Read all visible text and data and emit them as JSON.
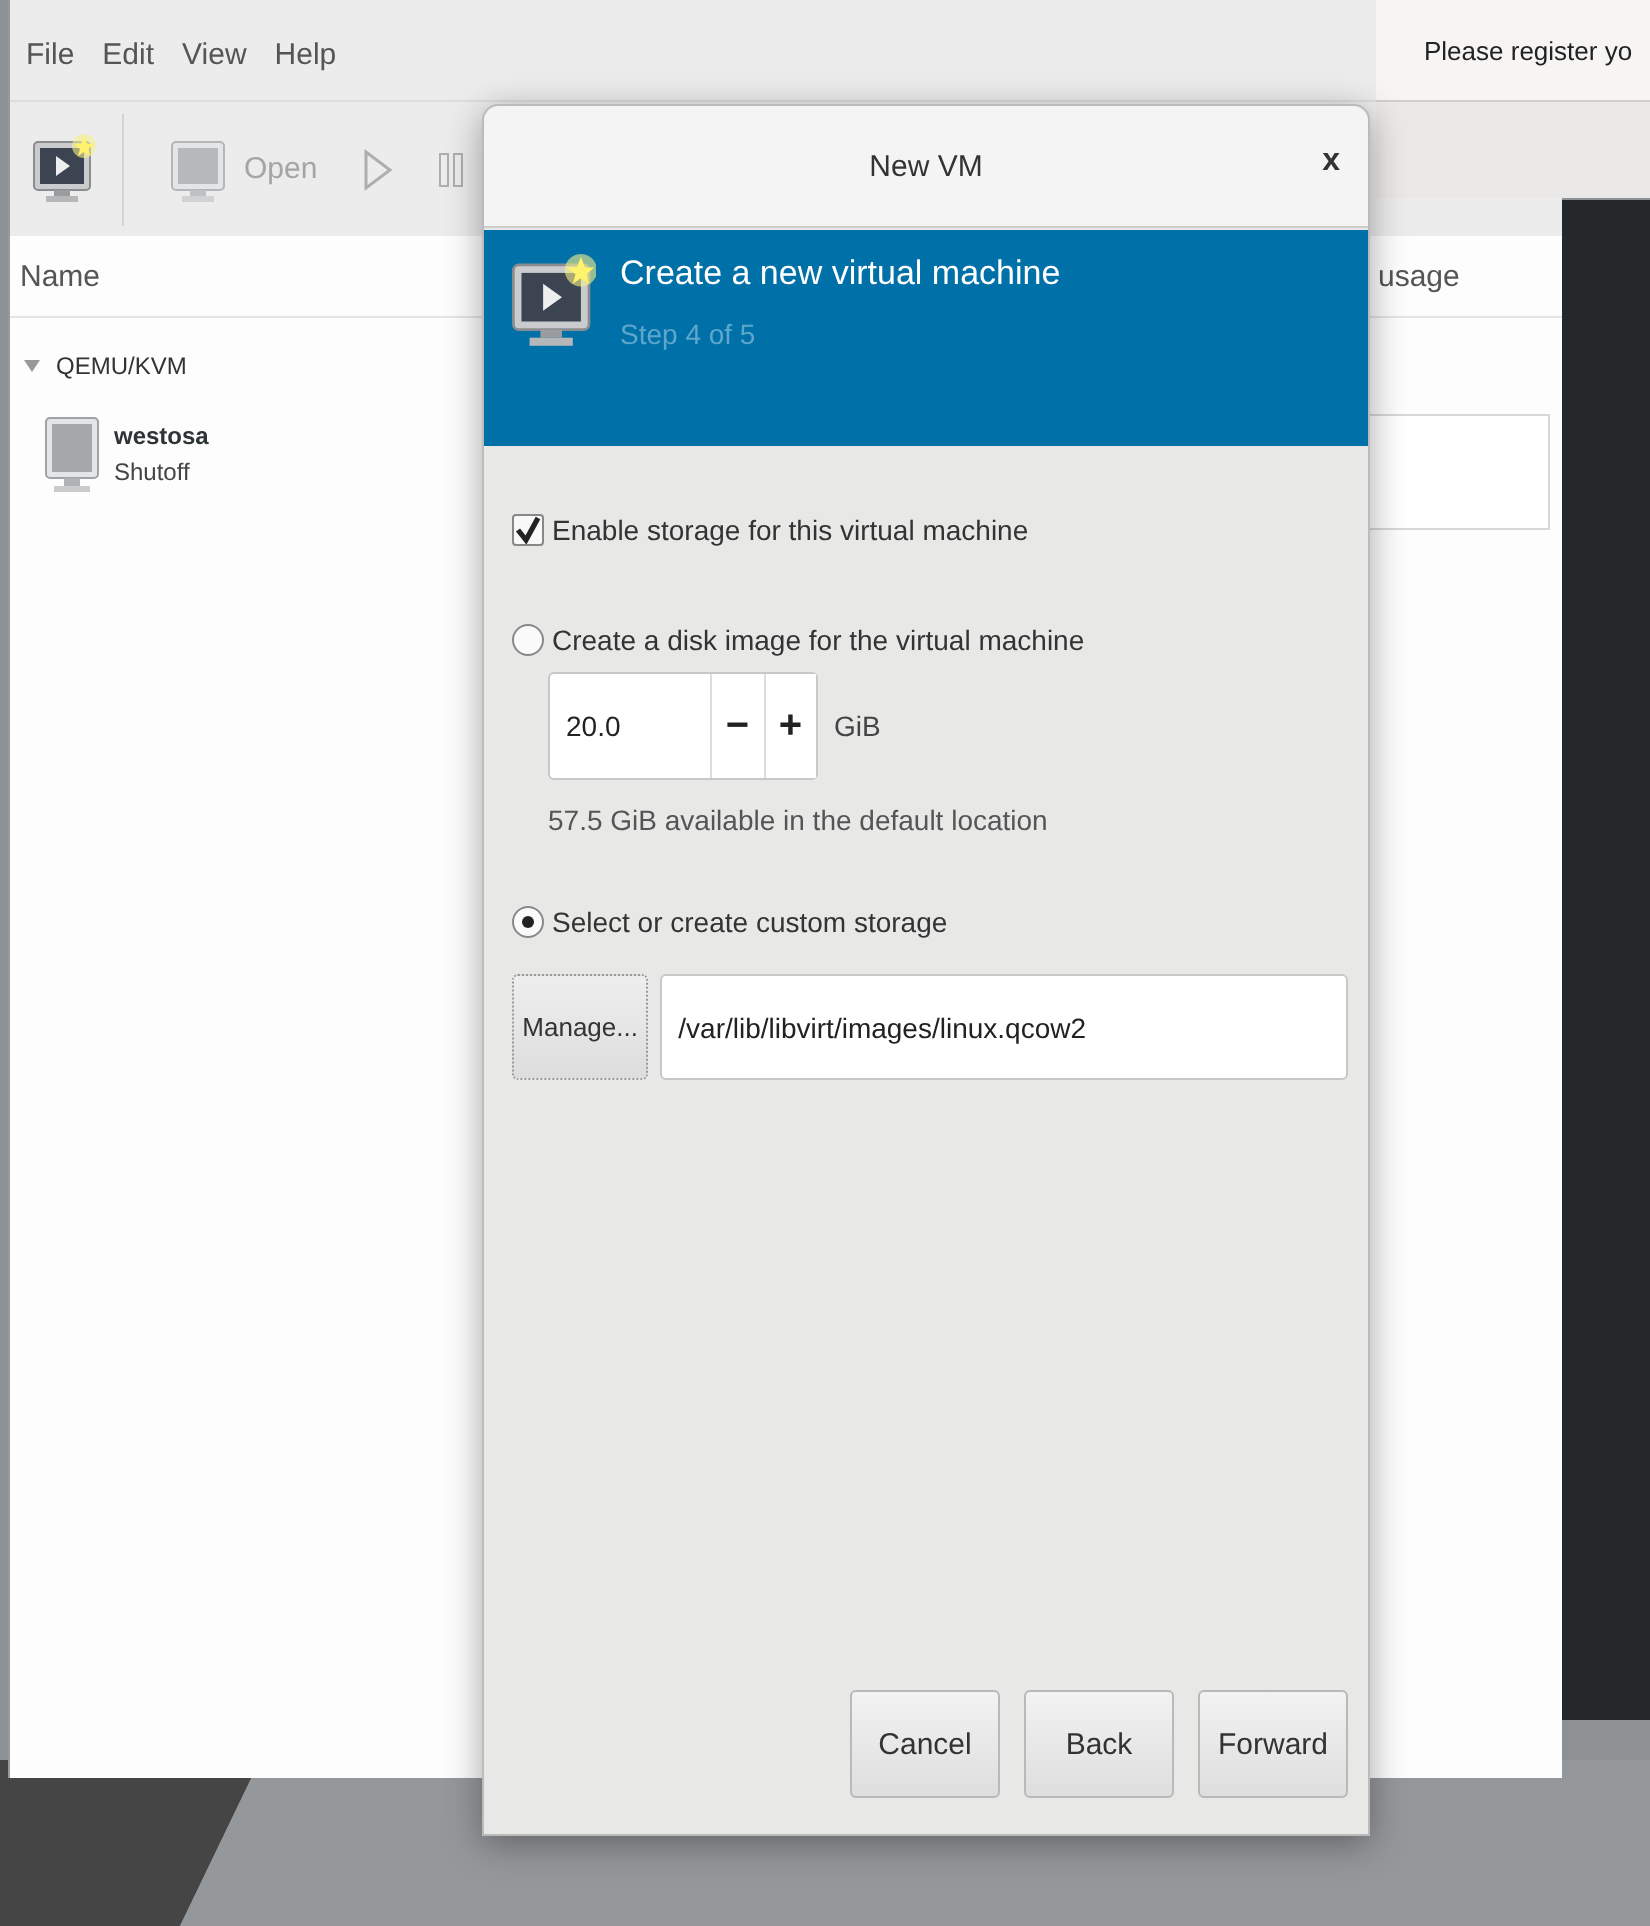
{
  "app_window": {
    "menu": [
      {
        "label": "File"
      },
      {
        "label": "Edit"
      },
      {
        "label": "View"
      },
      {
        "label": "Help"
      }
    ],
    "toolbar": [
      {
        "kind": "new",
        "disabled": false
      },
      {
        "kind": "open",
        "label": "Open",
        "disabled": true
      },
      {
        "kind": "run",
        "disabled": true
      },
      {
        "kind": "pause",
        "disabled": true
      }
    ],
    "columns": [
      "Name",
      "usage"
    ],
    "tree": [
      {
        "label": "QEMU/KVM",
        "expanded": true,
        "children": [
          {
            "name": "westosa",
            "status": "Shutoff"
          }
        ]
      }
    ]
  },
  "other_window": {
    "text": "Please register yo"
  },
  "dialog": {
    "title": "New VM",
    "close": "x",
    "header": {
      "title": "Create a new virtual machine",
      "step": "Step 4 of 5"
    },
    "enable_storage": {
      "label": "Enable storage for this virtual machine",
      "checked": true
    },
    "options": [
      {
        "kind": "disk",
        "label": "Create a disk image for the virtual machine",
        "selected": false,
        "size": "20.0",
        "minus": "−",
        "plus": "+",
        "unit": "GiB",
        "note": "57.5 GiB available in the default location"
      },
      {
        "kind": "custom",
        "label": "Select or create custom storage",
        "selected": true,
        "manage": "Manage...",
        "path": "/var/lib/libvirt/images/linux.qcow2"
      }
    ],
    "buttons": [
      "Cancel",
      "Back",
      "Forward"
    ]
  }
}
